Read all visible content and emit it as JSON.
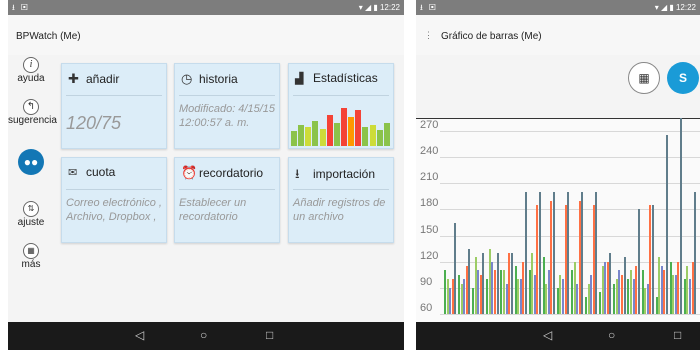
{
  "left": {
    "status_time": "12:22",
    "app_title": "BPWatch (Me)",
    "sidebar": [
      {
        "label": "ayuda",
        "icon": "info-icon"
      },
      {
        "label": "sugerencia",
        "icon": "reply-icon"
      },
      {
        "label": "",
        "icon": "people-icon"
      },
      {
        "label": "ajuste",
        "icon": "sliders-icon"
      },
      {
        "label": "más",
        "icon": "app-icon"
      }
    ],
    "cards": {
      "add": {
        "label": "añadir",
        "value": "120/75"
      },
      "history": {
        "label": "historia",
        "modified": "Modificado: 4/15/15 12:00:57 a. m."
      },
      "stats": {
        "label": "Estadísticas",
        "bars": [
          {
            "v": 0.35,
            "c": "#8bc34a"
          },
          {
            "v": 0.5,
            "c": "#8bc34a"
          },
          {
            "v": 0.45,
            "c": "#cddc39"
          },
          {
            "v": 0.6,
            "c": "#8bc34a"
          },
          {
            "v": 0.4,
            "c": "#cddc39"
          },
          {
            "v": 0.75,
            "c": "#f44336"
          },
          {
            "v": 0.55,
            "c": "#8bc34a"
          },
          {
            "v": 0.9,
            "c": "#f44336"
          },
          {
            "v": 0.7,
            "c": "#ff9800"
          },
          {
            "v": 0.85,
            "c": "#f44336"
          },
          {
            "v": 0.45,
            "c": "#8bc34a"
          },
          {
            "v": 0.5,
            "c": "#cddc39"
          },
          {
            "v": 0.38,
            "c": "#8bc34a"
          },
          {
            "v": 0.55,
            "c": "#8bc34a"
          }
        ]
      },
      "quota": {
        "label": "cuota",
        "text": "Correo electrónico , Archivo, Dropbox ,"
      },
      "reminder": {
        "label": "recordatorio",
        "text": "Establecer un recordatorio"
      },
      "import": {
        "label": "importación",
        "text": "Añadir registros de un archivo"
      }
    }
  },
  "right": {
    "status_time": "12:22",
    "app_title": "Gráfico de barras (Me)",
    "avatar_letter": "S"
  },
  "chart_data": {
    "type": "bar",
    "title": "Gráfico de barras (Me)",
    "yticks": [
      60,
      90,
      120,
      150,
      180,
      210,
      240,
      270
    ],
    "ylim": [
      60,
      285
    ],
    "series": [
      {
        "color": "#4caf50",
        "values": [
          110,
          105,
          90,
          100,
          110,
          115,
          110,
          125,
          90,
          110,
          80,
          85,
          95,
          100,
          110,
          80,
          120,
          100
        ]
      },
      {
        "color": "#9ccc65",
        "values": [
          100,
          95,
          125,
          135,
          110,
          100,
          130,
          95,
          105,
          120,
          95,
          115,
          100,
          110,
          90,
          125,
          105,
          115
        ]
      },
      {
        "color": "#7986cb",
        "values": [
          90,
          100,
          110,
          120,
          95,
          100,
          105,
          110,
          100,
          95,
          105,
          120,
          110,
          100,
          95,
          115,
          105,
          100
        ]
      },
      {
        "color": "#ff7043",
        "values": [
          100,
          115,
          105,
          110,
          130,
          120,
          185,
          190,
          185,
          190,
          185,
          120,
          105,
          115,
          185,
          110,
          120,
          120
        ]
      },
      {
        "color": "#607d8b",
        "values": [
          165,
          135,
          130,
          130,
          130,
          200,
          200,
          200,
          200,
          200,
          200,
          130,
          125,
          180,
          185,
          265,
          285,
          200
        ]
      }
    ]
  }
}
